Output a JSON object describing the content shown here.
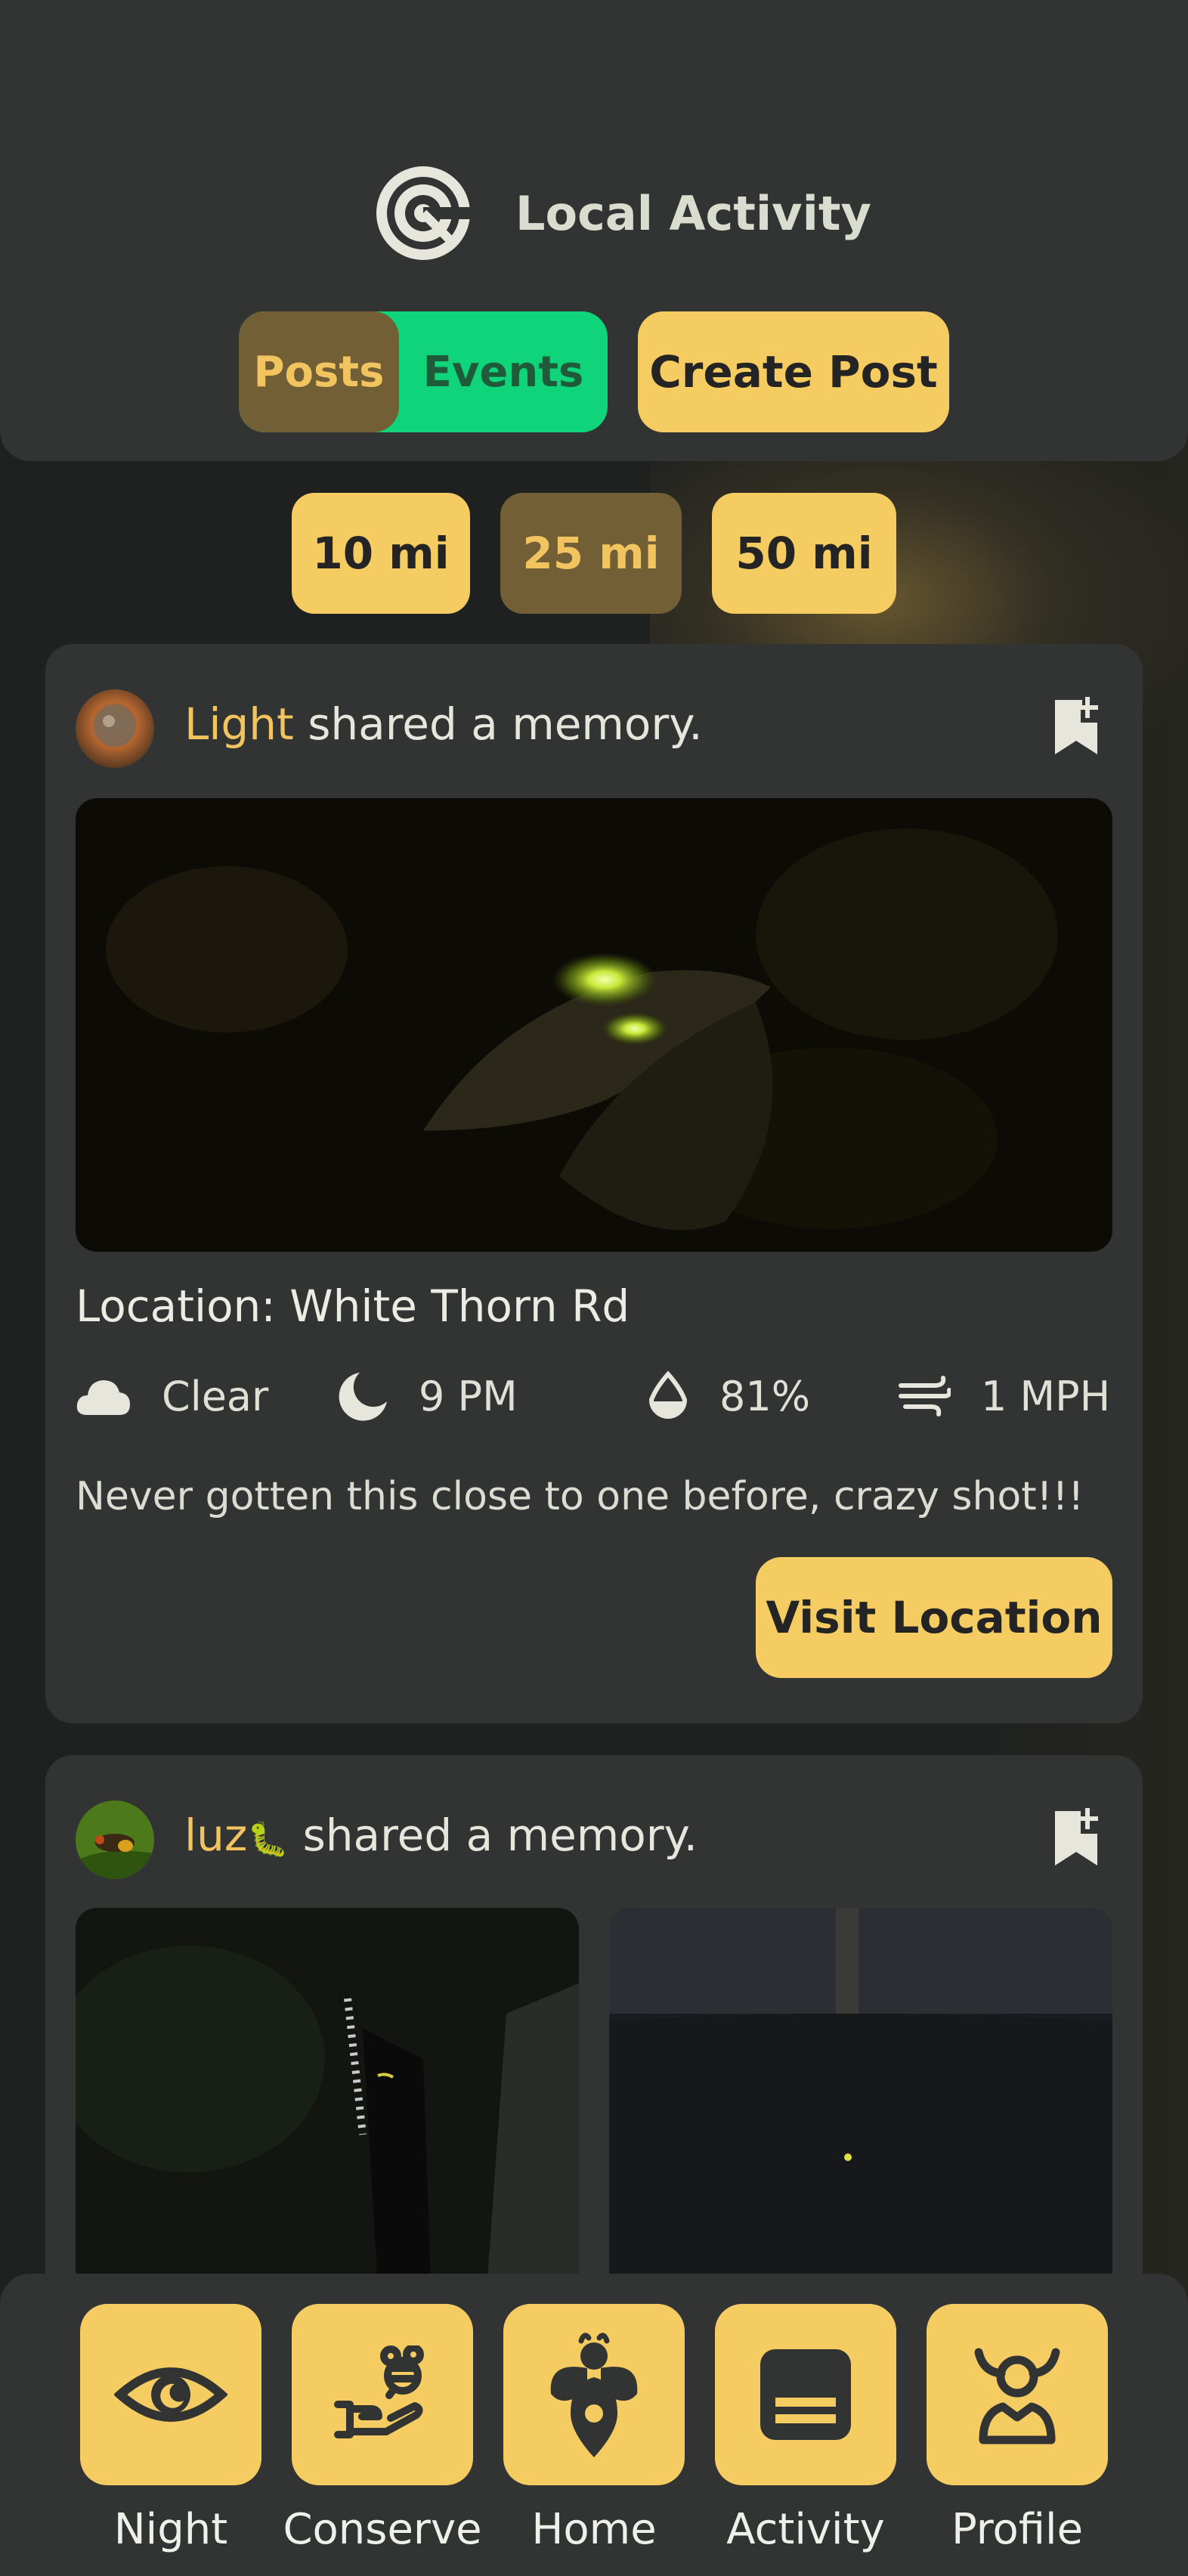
{
  "header": {
    "title": "Local Activity",
    "tabs": {
      "posts": "Posts",
      "events": "Events",
      "active": "Posts"
    },
    "create_post": "Create Post"
  },
  "distance_filters": [
    {
      "label": "10 mi",
      "active": false
    },
    {
      "label": "25 mi",
      "active": true
    },
    {
      "label": "50 mi",
      "active": false
    }
  ],
  "posts": [
    {
      "username": "Light",
      "action": "shared a memory.",
      "location": "Location: White Thorn Rd",
      "weather": {
        "condition": "Clear",
        "time": "9 PM",
        "humidity": "81%",
        "wind": "1 MPH"
      },
      "comment": "Never gotten this close to one before, crazy shot!!!",
      "visit_label": "Visit Location"
    },
    {
      "username": "luz",
      "username_emoji": "🐛",
      "action": "shared a memory."
    }
  ],
  "nav": [
    {
      "label": "Night",
      "icon": "eye-icon"
    },
    {
      "label": "Conserve",
      "icon": "hand-bee-icon"
    },
    {
      "label": "Home",
      "icon": "firefly-pin-icon"
    },
    {
      "label": "Activity",
      "icon": "list-icon"
    },
    {
      "label": "Profile",
      "icon": "person-icon"
    }
  ],
  "colors": {
    "background": "#1f2120",
    "panel": "#323433",
    "accent_yellow": "#f5cc62",
    "active_brown": "#735f35",
    "events_green": "#0fd47a",
    "username_gold": "#f2c45f"
  }
}
